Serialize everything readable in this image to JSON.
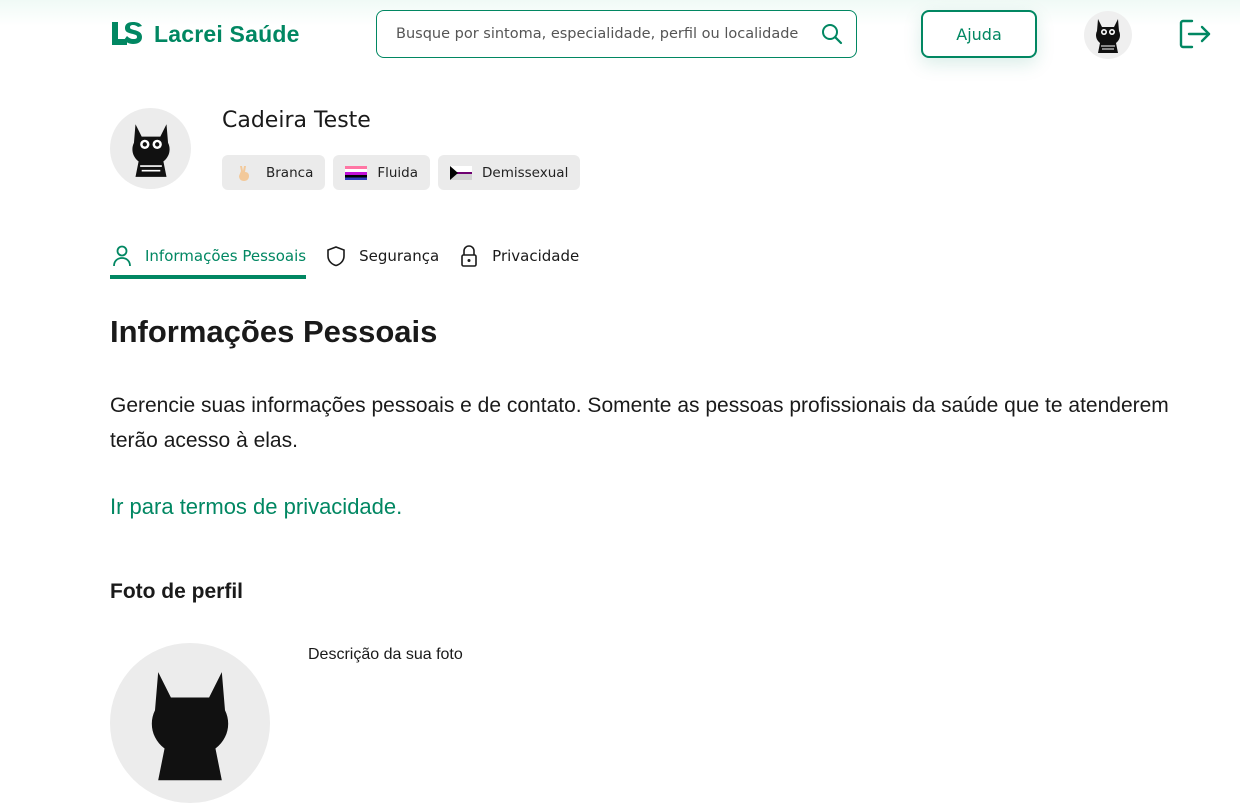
{
  "header": {
    "logo_text": "Lacrei Saúde",
    "search_placeholder": "Busque por sintoma, especialidade, perfil ou localidade",
    "search_value": "",
    "help_label": "Ajuda",
    "brand_color": "#018762"
  },
  "profile": {
    "name": "Cadeira Teste",
    "tags": [
      {
        "label": "Branca",
        "icon": "hand-emoji-icon"
      },
      {
        "label": "Fluida",
        "icon": "genderfluid-flag-icon"
      },
      {
        "label": "Demissexual",
        "icon": "demisexual-flag-icon"
      }
    ]
  },
  "tabs": [
    {
      "label": "Informações Pessoais",
      "icon": "person-icon",
      "active": true
    },
    {
      "label": "Segurança",
      "icon": "shield-icon",
      "active": false
    },
    {
      "label": "Privacidade",
      "icon": "lock-icon",
      "active": false
    }
  ],
  "main": {
    "title": "Informações Pessoais",
    "description": "Gerencie suas informações pessoais e de contato. Somente as pessoas profissionais da saúde que te atenderem terão acesso à elas.",
    "privacy_link": "Ir para termos de privacidade.",
    "photo_heading": "Foto de perfil",
    "photo_description_label": "Descrição da sua foto"
  }
}
